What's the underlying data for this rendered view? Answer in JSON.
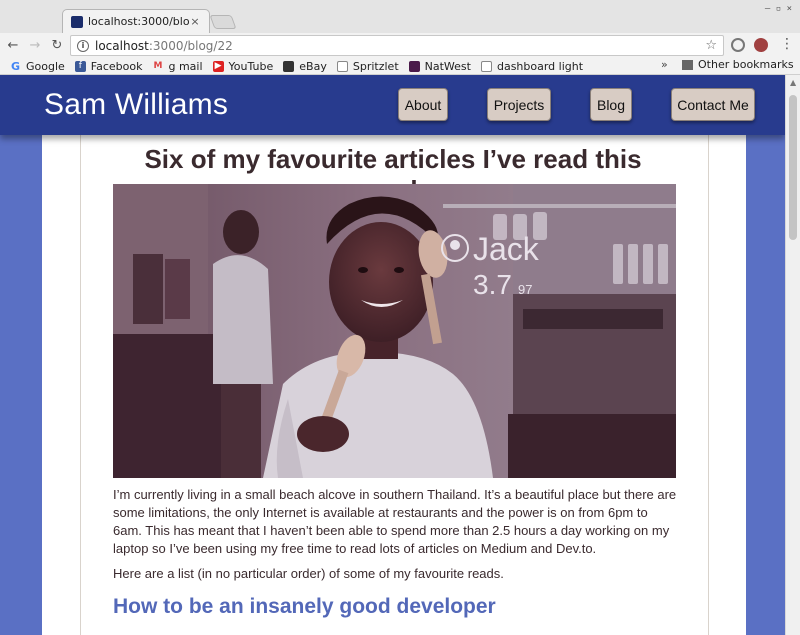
{
  "browser": {
    "tab_title": "localhost:3000/blo",
    "tab_close": "×",
    "window_controls": "– ▫ ×",
    "url_host": "localhost",
    "url_path": ":3000/blog/22",
    "bookmarks": [
      {
        "label": "Google",
        "icon": "google-icon"
      },
      {
        "label": "Facebook",
        "icon": "facebook-icon"
      },
      {
        "label": "g mail",
        "icon": "gmail-icon"
      },
      {
        "label": "YouTube",
        "icon": "youtube-icon"
      },
      {
        "label": "eBay",
        "icon": "ebay-icon"
      },
      {
        "label": "Spritzlet",
        "icon": "page-icon"
      },
      {
        "label": "NatWest",
        "icon": "natwest-icon"
      },
      {
        "label": "dashboard light",
        "icon": "page-icon"
      }
    ],
    "more_bookmarks": "»",
    "other_bookmarks": "Other bookmarks"
  },
  "site": {
    "title": "Sam Williams",
    "nav": [
      "About",
      "Projects",
      "Blog",
      "Contact Me"
    ]
  },
  "article": {
    "title": "Six of my favourite articles I’ve read this week",
    "image_overlay_name": "Jack",
    "image_overlay_score": "3.7",
    "image_overlay_score_small": "97",
    "paragraph1": "I’m currently living in a small beach alcove in southern Thailand. It’s a beautiful place but there are some limitations, the only Internet is available at restaurants and the power is on from 6pm to 6am. This has meant that I haven’t been able to spend more than 2.5 hours a day working on my laptop so I’ve been using my free time to read lots of articles on Medium and Dev.to.",
    "paragraph2": "Here are a list (in no particular order) of some of my favourite reads.",
    "heading2": "How to be an insanely good developer"
  },
  "colors": {
    "header_bg": "#283b8e",
    "page_bg": "#5a70c4",
    "link_heading": "#5368b8",
    "nav_button_bg": "#d8ccc4"
  }
}
